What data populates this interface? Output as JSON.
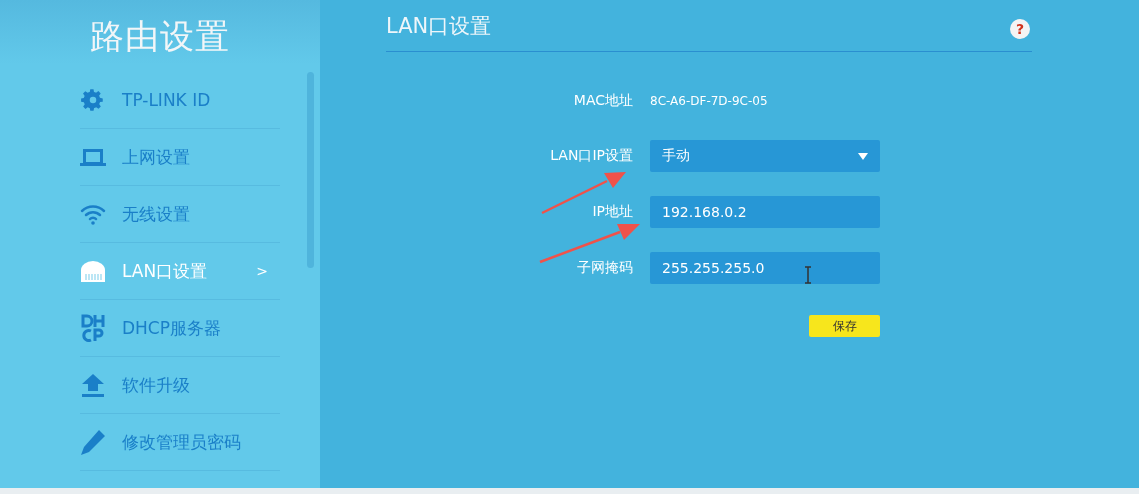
{
  "sidebar": {
    "title": "路由设置",
    "items": [
      {
        "label": "TP-LINK ID",
        "selected": false
      },
      {
        "label": "上网设置",
        "selected": false
      },
      {
        "label": "无线设置",
        "selected": false
      },
      {
        "label": "LAN口设置",
        "selected": true,
        "marker": ">"
      },
      {
        "label": "DHCP服务器",
        "selected": false
      },
      {
        "label": "软件升级",
        "selected": false
      },
      {
        "label": "修改管理员密码",
        "selected": false
      }
    ]
  },
  "panel": {
    "title": "LAN口设置",
    "help": "?",
    "fields": [
      {
        "kind": "text",
        "label": "MAC地址",
        "value": "8C-A6-DF-7D-9C-05"
      },
      {
        "kind": "select",
        "label": "LAN口IP设置",
        "value": "手动"
      },
      {
        "kind": "input",
        "label": "IP地址",
        "value": "192.168.0.2"
      },
      {
        "kind": "input",
        "label": "子网掩码",
        "value": "255.255.255.0"
      }
    ],
    "save_button": "保存"
  }
}
